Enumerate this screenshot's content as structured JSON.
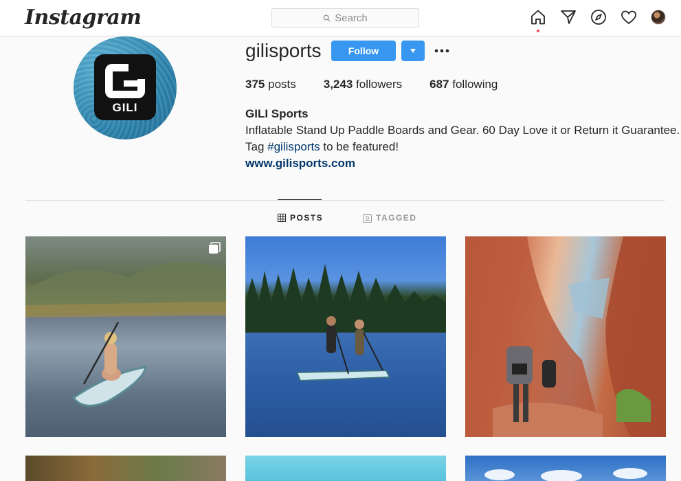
{
  "nav": {
    "logo": "Instagram",
    "search_placeholder": "Search",
    "icons": [
      "home-icon",
      "direct-icon",
      "explore-icon",
      "activity-heart-icon",
      "profile-avatar"
    ]
  },
  "profile": {
    "username": "gilisports",
    "follow_label": "Follow",
    "picture_text": "GILI",
    "stats": {
      "posts_count": "375",
      "posts_label": "posts",
      "followers_count": "3,243",
      "followers_label": "followers",
      "following_count": "687",
      "following_label": "following"
    },
    "bio": {
      "name": "GILI Sports",
      "line1": "Inflatable Stand Up Paddle Boards and Gear. 60 Day Love it or Return it Guarantee.",
      "line2_prefix": "Tag ",
      "hashtag": "#gilisports",
      "line2_suffix": " to be featured!",
      "website": "www.gilisports.com"
    }
  },
  "tabs": {
    "posts": "POSTS",
    "tagged": "TAGGED",
    "active": "POSTS"
  },
  "colors": {
    "accent": "#3897f0",
    "text": "#262626",
    "muted": "#8e8e8e",
    "border": "#dbdbdb"
  }
}
